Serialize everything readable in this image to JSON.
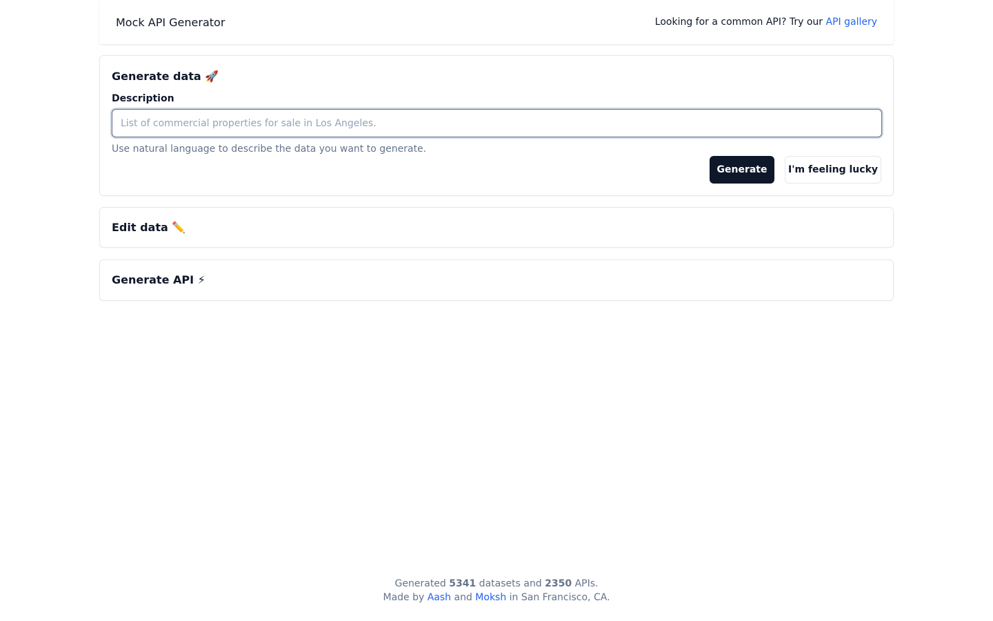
{
  "header": {
    "brand": "Mock API Generator",
    "prompt_text": "Looking for a common API? Try our ",
    "gallery_link": "API gallery"
  },
  "generate_data": {
    "title": "Generate data 🚀",
    "description_label": "Description",
    "input_placeholder": "List of commercial properties for sale in Los Angeles.",
    "input_value": "",
    "hint": "Use natural language to describe the data you want to generate.",
    "generate_label": "Generate",
    "lucky_label": "I'm feeling lucky"
  },
  "edit_data": {
    "title": "Edit data ✏️"
  },
  "generate_api": {
    "title": "Generate API ⚡"
  },
  "footer": {
    "generated_prefix": "Generated ",
    "datasets_count": "5341",
    "datasets_middle": " datasets and ",
    "apis_count": "2350",
    "apis_suffix": " APIs.",
    "made_by_prefix": "Made by ",
    "author1": "Aash",
    "and_text": " and ",
    "author2": "Moksh",
    "location_suffix": " in San Francisco, CA."
  },
  "colors": {
    "primary_button": "#0f172a",
    "link": "#2563eb",
    "muted_text": "#64748b"
  }
}
